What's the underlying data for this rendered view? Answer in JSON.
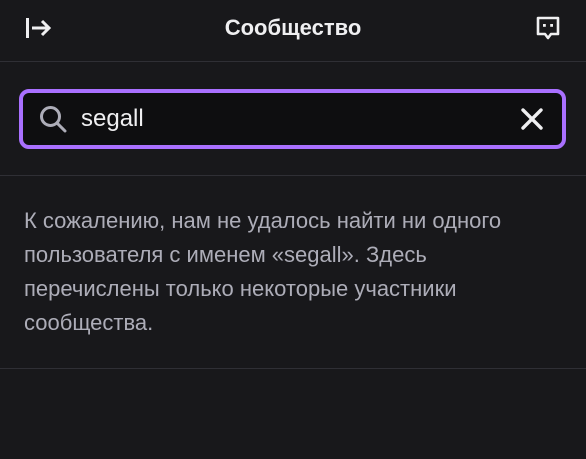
{
  "header": {
    "title": "Сообщество",
    "collapse_icon": "arrow-right-to-bar-icon",
    "chat_icon": "chat-bubble-icon"
  },
  "search": {
    "value": "segall",
    "icon": "search-icon",
    "clear_icon": "close-icon",
    "border_color": "#a970ff"
  },
  "result": {
    "message": "К сожалению, нам не удалось найти ни одного пользователя с именем «segall». Здесь перечислены только некоторые участники сообщества."
  },
  "colors": {
    "background": "#18181b",
    "accent": "#a970ff",
    "text_primary": "#efeff1",
    "text_secondary": "#adadb8",
    "divider": "#2f2f35"
  }
}
